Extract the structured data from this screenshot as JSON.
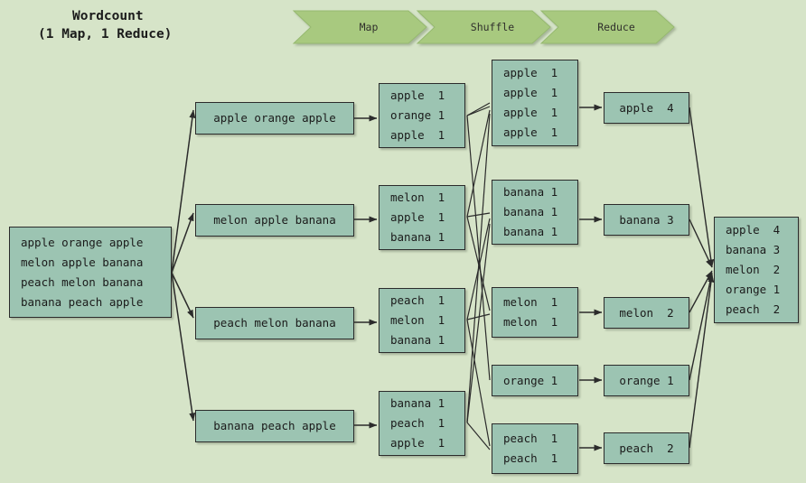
{
  "title": {
    "line1": "Wordcount",
    "line2": "(1 Map, 1 Reduce)"
  },
  "colors": {
    "background": "#d6e4c8",
    "box_fill": "#9cc4b2",
    "box_border": "#2b2b2b",
    "chevron_fill": "#a8c97f",
    "chevron_border": "#8fae6b",
    "edge": "#2b2b2b",
    "text": "#1b1b1b"
  },
  "phases": [
    {
      "label": "Map"
    },
    {
      "label": "Shuffle"
    },
    {
      "label": "Reduce"
    }
  ],
  "input": {
    "name": "input-document",
    "lines": [
      "apple orange apple",
      "melon apple banana",
      "peach melon banana",
      "banana peach apple"
    ]
  },
  "splits": [
    {
      "text": "apple orange apple"
    },
    {
      "text": "melon apple banana"
    },
    {
      "text": "peach melon banana"
    },
    {
      "text": "banana peach apple"
    }
  ],
  "map_outputs": [
    {
      "pairs": [
        {
          "key": "apple",
          "value": "1"
        },
        {
          "key": "orange",
          "value": "1"
        },
        {
          "key": "apple",
          "value": "1"
        }
      ]
    },
    {
      "pairs": [
        {
          "key": "melon",
          "value": "1"
        },
        {
          "key": "apple",
          "value": "1"
        },
        {
          "key": "banana",
          "value": "1"
        }
      ]
    },
    {
      "pairs": [
        {
          "key": "peach",
          "value": "1"
        },
        {
          "key": "melon",
          "value": "1"
        },
        {
          "key": "banana",
          "value": "1"
        }
      ]
    },
    {
      "pairs": [
        {
          "key": "banana",
          "value": "1"
        },
        {
          "key": "peach",
          "value": "1"
        },
        {
          "key": "apple",
          "value": "1"
        }
      ]
    }
  ],
  "shuffle_groups": [
    {
      "key": "apple",
      "pairs": [
        {
          "key": "apple",
          "value": "1"
        },
        {
          "key": "apple",
          "value": "1"
        },
        {
          "key": "apple",
          "value": "1"
        },
        {
          "key": "apple",
          "value": "1"
        }
      ]
    },
    {
      "key": "banana",
      "pairs": [
        {
          "key": "banana",
          "value": "1"
        },
        {
          "key": "banana",
          "value": "1"
        },
        {
          "key": "banana",
          "value": "1"
        }
      ]
    },
    {
      "key": "melon",
      "pairs": [
        {
          "key": "melon",
          "value": "1"
        },
        {
          "key": "melon",
          "value": "1"
        }
      ]
    },
    {
      "key": "orange",
      "pairs": [
        {
          "key": "orange",
          "value": "1"
        }
      ]
    },
    {
      "key": "peach",
      "pairs": [
        {
          "key": "peach",
          "value": "1"
        },
        {
          "key": "peach",
          "value": "1"
        }
      ]
    }
  ],
  "reduce_outputs": [
    {
      "key": "apple",
      "value": "4"
    },
    {
      "key": "banana",
      "value": "3"
    },
    {
      "key": "melon",
      "value": "2"
    },
    {
      "key": "orange",
      "value": "1"
    },
    {
      "key": "peach",
      "value": "2"
    }
  ],
  "final_output": {
    "pairs": [
      {
        "key": "apple",
        "value": "4"
      },
      {
        "key": "banana",
        "value": "3"
      },
      {
        "key": "melon",
        "value": "2"
      },
      {
        "key": "orange",
        "value": "1"
      },
      {
        "key": "peach",
        "value": "2"
      }
    ]
  }
}
